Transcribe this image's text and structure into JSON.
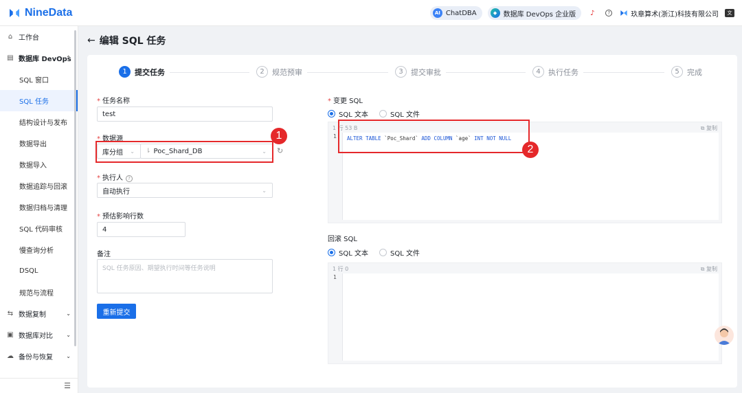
{
  "app": {
    "logo_text": "NineData"
  },
  "topbar": {
    "chatdba_label": "ChatDBA",
    "chatdba_badge": "AI",
    "devops_label": "数据库 DevOps 企业版",
    "company_name": "玖章算术(浙江)科技有限公司"
  },
  "sidebar": {
    "workbench": "工作台",
    "devops_group": "数据库 DevOps",
    "items": [
      {
        "label": "SQL 窗口"
      },
      {
        "label": "SQL 任务"
      },
      {
        "label": "结构设计与发布"
      },
      {
        "label": "数据导出"
      },
      {
        "label": "数据导入"
      },
      {
        "label": "数据追踪与回滚"
      },
      {
        "label": "数据归档与清理"
      },
      {
        "label": "SQL 代码审核"
      },
      {
        "label": "慢查询分析"
      },
      {
        "label": "DSQL"
      },
      {
        "label": "规范与流程"
      }
    ],
    "groups": [
      {
        "label": "数据复制"
      },
      {
        "label": "数据库对比"
      },
      {
        "label": "备份与恢复"
      }
    ]
  },
  "page": {
    "title": "编辑 SQL 任务"
  },
  "steps": [
    {
      "num": "1",
      "label": "提交任务"
    },
    {
      "num": "2",
      "label": "规范预审"
    },
    {
      "num": "3",
      "label": "提交审批"
    },
    {
      "num": "4",
      "label": "执行任务"
    },
    {
      "num": "5",
      "label": "完成"
    }
  ],
  "form": {
    "task_name_label": "任务名称",
    "task_name_value": "test",
    "datasource_label": "数据源",
    "datasource_type": "库分组",
    "datasource_value": "Poc_Shard_DB",
    "executor_label": "执行人",
    "executor_value": "自动执行",
    "rows_label": "预估影响行数",
    "rows_value": "4",
    "remark_label": "备注",
    "remark_placeholder": "SQL 任务原因、期望执行时间等任务说明",
    "resubmit_button": "重新提交"
  },
  "change_sql": {
    "label": "变更 SQL",
    "radio_text": "SQL 文本",
    "radio_file": "SQL 文件",
    "meta": "1 行  53 B",
    "copy": "复制",
    "line_no": "1",
    "code": "ALTER TABLE `Poc_Shard` ADD COLUMN `age` INT NOT NULL"
  },
  "rollback_sql": {
    "label": "回滚 SQL",
    "radio_text": "SQL 文本",
    "radio_file": "SQL 文件",
    "meta": "1 行  0",
    "copy": "复制",
    "line_no": "1"
  },
  "annotations": [
    {
      "num": "1"
    },
    {
      "num": "2"
    }
  ],
  "colors": {
    "primary": "#1a6fe8",
    "annotation": "#e5282a",
    "required": "#e54545"
  }
}
